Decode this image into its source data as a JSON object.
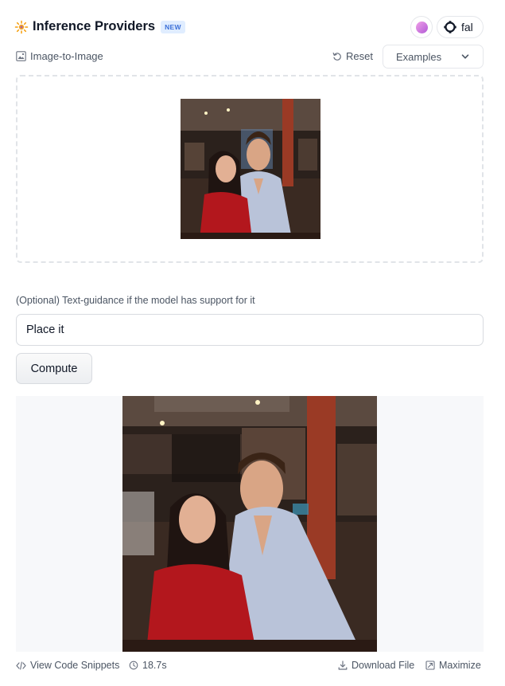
{
  "header": {
    "title": "Inference Providers",
    "badge": "NEW",
    "provider_name": "fal",
    "provider_avatar_color": "#c06ee0"
  },
  "task": {
    "label": "Image-to-Image",
    "reset_label": "Reset",
    "examples_label": "Examples"
  },
  "input_image": {
    "alt": "couple photo thumbnail"
  },
  "guidance": {
    "label": "(Optional) Text-guidance if the model has support for it",
    "value": "Place it"
  },
  "compute_label": "Compute",
  "output_image": {
    "alt": "generated couple photo"
  },
  "footer": {
    "code_snippets": "View Code Snippets",
    "time": "18.7s",
    "download": "Download File",
    "maximize": "Maximize"
  },
  "icons": {
    "title": "sparkle-icon",
    "provider": "fal-logo-icon",
    "task": "image-icon",
    "reset": "reset-icon",
    "examples": "chevron-down-icon",
    "code": "code-icon",
    "time": "clock-icon",
    "download": "download-icon",
    "maximize": "maximize-icon"
  }
}
